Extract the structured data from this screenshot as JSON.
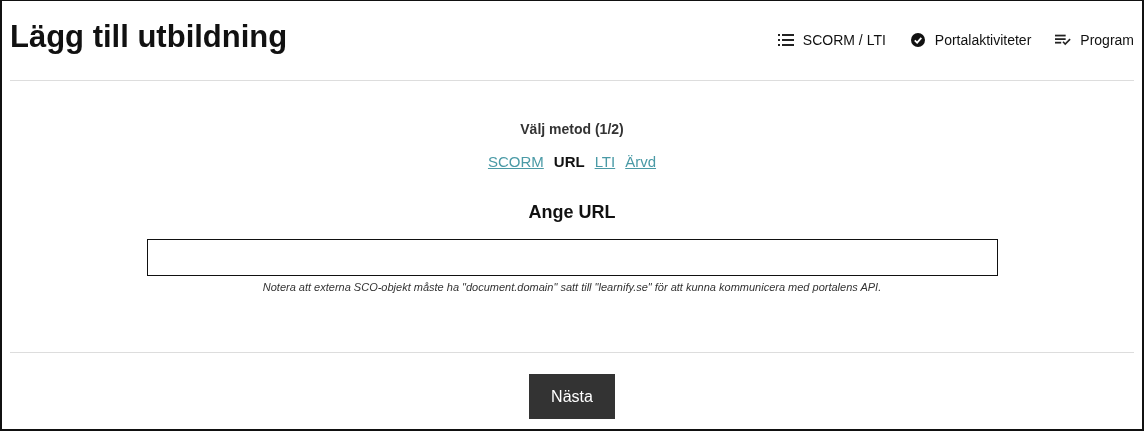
{
  "title": "Lägg till utbildning",
  "actions": [
    {
      "label": "SCORM / LTI",
      "kind": "list"
    },
    {
      "label": "Portalaktiviteter",
      "kind": "check"
    },
    {
      "label": "Program",
      "kind": "program"
    }
  ],
  "method_label": "Välj metod (1/2)",
  "methods": [
    {
      "label": "SCORM",
      "selected": false
    },
    {
      "label": "URL",
      "selected": true
    },
    {
      "label": "LTI",
      "selected": false
    },
    {
      "label": "Ärvd",
      "selected": false
    }
  ],
  "section_title": "Ange URL",
  "note": "Notera att externa SCO-objekt måste ha \"document.domain\" satt till \"learnify.se\" för att kunna kommunicera med portalens API.",
  "next_button": "Nästa"
}
